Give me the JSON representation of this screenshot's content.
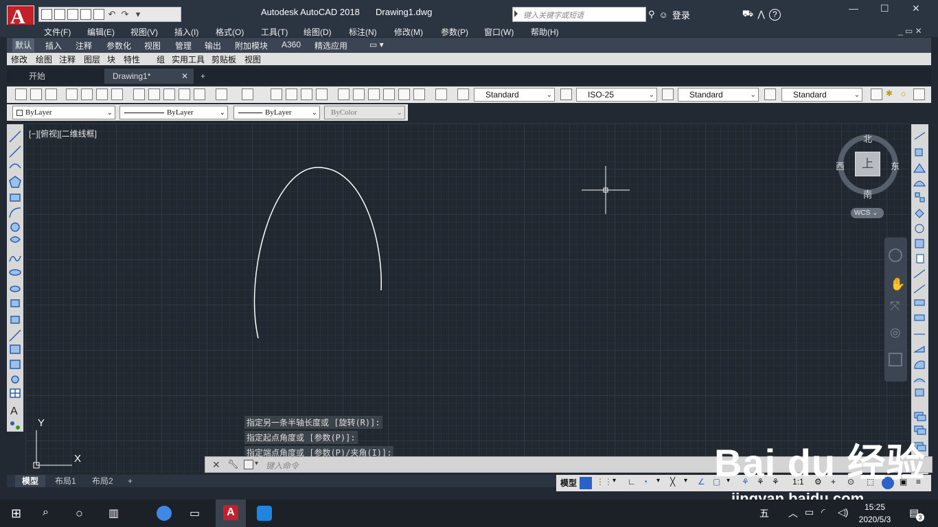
{
  "title_bar": {
    "app_title": "Autodesk AutoCAD 2018",
    "document": "Drawing1.dwg",
    "search_placeholder": "键入关键字或短语",
    "login": "登录",
    "help": "?"
  },
  "menu": [
    "文件(F)",
    "编辑(E)",
    "视图(V)",
    "插入(I)",
    "格式(O)",
    "工具(T)",
    "绘图(D)",
    "标注(N)",
    "修改(M)",
    "参数(P)",
    "窗口(W)",
    "帮助(H)"
  ],
  "ribbon_tabs": [
    "默认",
    "插入",
    "注释",
    "参数化",
    "视图",
    "管理",
    "输出",
    "附加模块",
    "A360",
    "精选应用"
  ],
  "panel_tabs": [
    "修改",
    "绘图",
    "注释",
    "图层",
    "块",
    "特性",
    "组",
    "实用工具",
    "剪贴板",
    "视图"
  ],
  "doc_tabs": [
    "开始",
    "Drawing1*",
    "+"
  ],
  "styles": {
    "text_style": "Standard",
    "dim_style": "ISO-25",
    "table_style": "Standard",
    "mleader_style": "Standard"
  },
  "properties": {
    "layer": "ByLayer",
    "linetype": "ByLayer",
    "lineweight": "ByLayer",
    "color": "ByColor"
  },
  "viewport_label": "[−][俯视][二维线框]",
  "viewcube": {
    "north": "北",
    "south": "南",
    "east": "东",
    "west": "西",
    "top": "上",
    "wcs": "WCS"
  },
  "ucs": {
    "x": "X",
    "y": "Y"
  },
  "command_history": [
    "指定另一条半轴长度或 [旋转(R)]:",
    "指定起点角度或 [参数(P)]:",
    "指定端点角度或 [参数(P)/夹角(I)]:"
  ],
  "command_placeholder": "键入命令",
  "layout_tabs": [
    "模型",
    "布局1",
    "布局2",
    "+"
  ],
  "status": {
    "mode": "模型",
    "scale": "1:1"
  },
  "taskbar": {
    "time": "15:25",
    "date": "2020/5/3",
    "notif": "3",
    "ime": "五"
  },
  "watermark": {
    "brand": "Bai du 经验",
    "url": "jingyan.baidu.com"
  }
}
